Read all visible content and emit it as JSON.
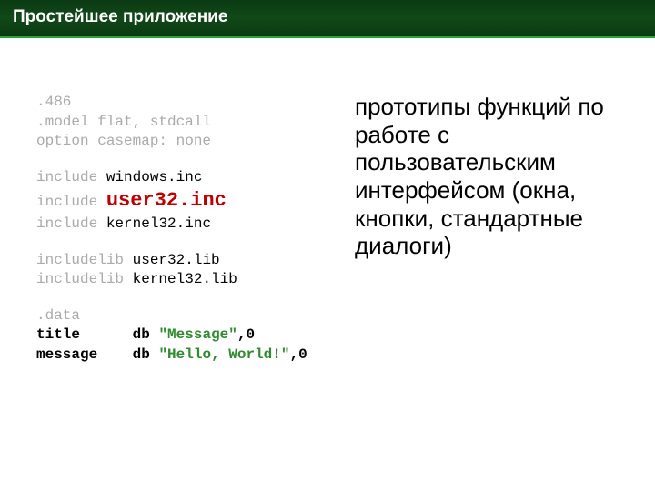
{
  "header": {
    "title": "Простейшее приложение"
  },
  "code": {
    "l1": ".486",
    "l2": ".model flat, stdcall",
    "l3": "option casemap: none",
    "inc_kw": "include",
    "inc1": "windows.inc",
    "inc2": "user32.inc",
    "inc3": "kernel32.inc",
    "inclib_kw": "includelib",
    "lib1": "user32.lib",
    "lib2": "kernel32.lib",
    "data_dir": ".data",
    "title_lbl": "title",
    "db_kw": "db",
    "title_str": "\"Message\"",
    "zero": ",0",
    "msg_lbl": "message",
    "msg_str": "\"Hello, World!\""
  },
  "desc": {
    "text": "прототипы функций по работе с пользовательским интерфейсом (окна, кнопки, стандартные диалоги)"
  }
}
